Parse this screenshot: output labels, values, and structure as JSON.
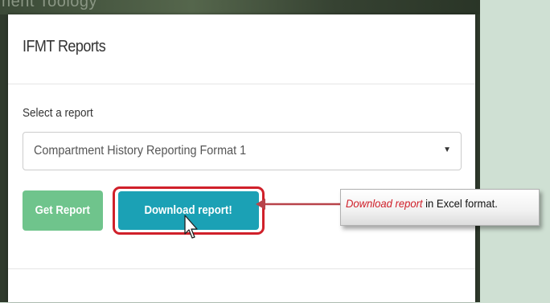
{
  "background": {
    "partial_text": "nent Toology"
  },
  "modal": {
    "title": "IFMT Reports",
    "select_label": "Select a report",
    "select_value": "Compartment History Reporting Format 1",
    "get_report_label": "Get Report",
    "download_label": "Download report!"
  },
  "callout": {
    "emphasis": "Download report",
    "rest": " in Excel format."
  },
  "colors": {
    "get_report": "#6fc48c",
    "download": "#1ba1b5",
    "highlight": "#d0202a",
    "backdrop": "#cfe0d3"
  },
  "icons": {
    "caret": "caret-down-icon",
    "cursor": "mouse-pointer-icon",
    "arrow": "arrow-left-icon"
  }
}
